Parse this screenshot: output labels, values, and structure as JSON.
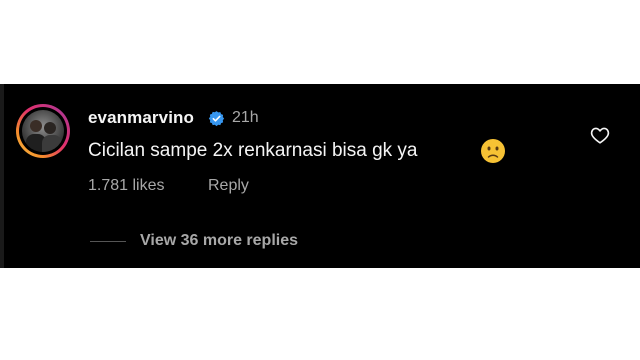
{
  "comment": {
    "username": "evanmarvino",
    "verified_icon": "verified-badge-icon",
    "time": "21h",
    "text": "Cicilan sampe 2x renkarnasi bisa gk ya",
    "emoji": "slightly-frowning-face",
    "likes": "1.781 likes",
    "reply_label": "Reply",
    "like_icon": "heart-outline-icon"
  },
  "replies": {
    "view_label": "View 36 more replies"
  },
  "colors": {
    "background": "#000000",
    "primary_text": "#f5f5f5",
    "secondary_text": "#a8a8a8",
    "verified_blue": "#3797f0"
  }
}
